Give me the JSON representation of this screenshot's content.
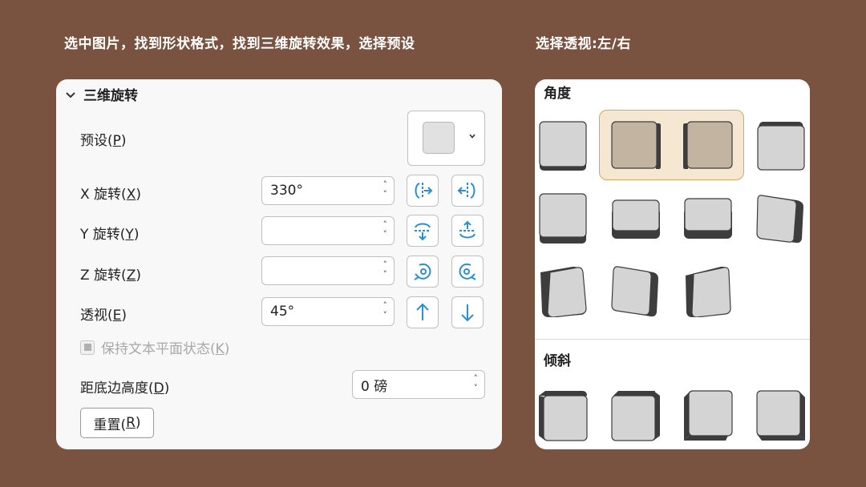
{
  "captions": {
    "left": "选中图片，找到形状格式，找到三维旋转效果，选择预设",
    "right": "选择透视:左/右"
  },
  "panel": {
    "section_title": "三维旋转",
    "preset_label": "预设(",
    "preset_key": "P",
    "x_label": "X 旋转(",
    "x_key": "X",
    "x_value": "330°",
    "y_label": "Y 旋转(",
    "y_key": "Y",
    "y_value": "",
    "z_label": "Z 旋转(",
    "z_key": "Z",
    "z_value": "",
    "persp_label": "透视(",
    "persp_key": "E",
    "persp_value": "45°",
    "keep_text_label": "保持文本平面状态(",
    "keep_text_key": "K",
    "distance_label": "距底边高度(",
    "distance_key": "D",
    "distance_value": "0 磅",
    "reset_label": "重置(",
    "reset_key": "R",
    "close_paren": ")"
  },
  "gallery": {
    "angle_title": "角度",
    "tilt_title": "倾斜"
  },
  "colors": {
    "background": "#7a5340",
    "highlight_fill": "#f5e7d2",
    "highlight_border": "#d2a860",
    "icon_blue": "#2a8fd0",
    "tile_face": "#d4d4d4",
    "tile_face_selected": "#c2b4a0",
    "tile_side": "#3d3d3d"
  }
}
